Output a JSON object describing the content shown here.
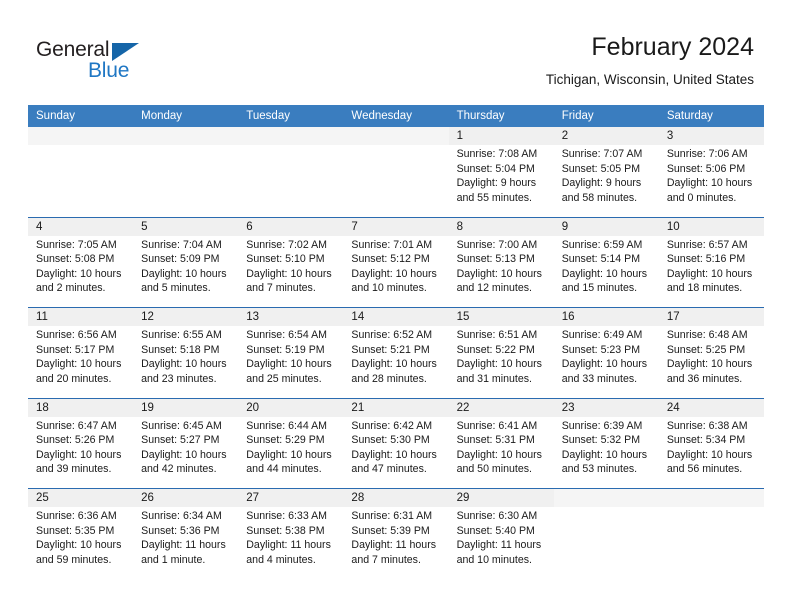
{
  "brand": {
    "name_part1": "General",
    "name_part2": "Blue",
    "triangle_color": "#1565a8",
    "blue_color": "#1f77c4"
  },
  "header": {
    "title": "February 2024",
    "subtitle": "Tichigan, Wisconsin, United States"
  },
  "theme": {
    "header_bar_color": "#3a7dbf",
    "row_rule_color": "#2a6bb0",
    "daynum_band_color": "#f0f0f0"
  },
  "weekday_headers": [
    "Sunday",
    "Monday",
    "Tuesday",
    "Wednesday",
    "Thursday",
    "Friday",
    "Saturday"
  ],
  "weeks": [
    {
      "days": [
        {
          "date": "",
          "sunrise": "",
          "sunset": "",
          "daylight_line1": "",
          "daylight_line2": ""
        },
        {
          "date": "",
          "sunrise": "",
          "sunset": "",
          "daylight_line1": "",
          "daylight_line2": ""
        },
        {
          "date": "",
          "sunrise": "",
          "sunset": "",
          "daylight_line1": "",
          "daylight_line2": ""
        },
        {
          "date": "",
          "sunrise": "",
          "sunset": "",
          "daylight_line1": "",
          "daylight_line2": ""
        },
        {
          "date": "1",
          "sunrise": "Sunrise: 7:08 AM",
          "sunset": "Sunset: 5:04 PM",
          "daylight_line1": "Daylight: 9 hours",
          "daylight_line2": "and 55 minutes."
        },
        {
          "date": "2",
          "sunrise": "Sunrise: 7:07 AM",
          "sunset": "Sunset: 5:05 PM",
          "daylight_line1": "Daylight: 9 hours",
          "daylight_line2": "and 58 minutes."
        },
        {
          "date": "3",
          "sunrise": "Sunrise: 7:06 AM",
          "sunset": "Sunset: 5:06 PM",
          "daylight_line1": "Daylight: 10 hours",
          "daylight_line2": "and 0 minutes."
        }
      ]
    },
    {
      "days": [
        {
          "date": "4",
          "sunrise": "Sunrise: 7:05 AM",
          "sunset": "Sunset: 5:08 PM",
          "daylight_line1": "Daylight: 10 hours",
          "daylight_line2": "and 2 minutes."
        },
        {
          "date": "5",
          "sunrise": "Sunrise: 7:04 AM",
          "sunset": "Sunset: 5:09 PM",
          "daylight_line1": "Daylight: 10 hours",
          "daylight_line2": "and 5 minutes."
        },
        {
          "date": "6",
          "sunrise": "Sunrise: 7:02 AM",
          "sunset": "Sunset: 5:10 PM",
          "daylight_line1": "Daylight: 10 hours",
          "daylight_line2": "and 7 minutes."
        },
        {
          "date": "7",
          "sunrise": "Sunrise: 7:01 AM",
          "sunset": "Sunset: 5:12 PM",
          "daylight_line1": "Daylight: 10 hours",
          "daylight_line2": "and 10 minutes."
        },
        {
          "date": "8",
          "sunrise": "Sunrise: 7:00 AM",
          "sunset": "Sunset: 5:13 PM",
          "daylight_line1": "Daylight: 10 hours",
          "daylight_line2": "and 12 minutes."
        },
        {
          "date": "9",
          "sunrise": "Sunrise: 6:59 AM",
          "sunset": "Sunset: 5:14 PM",
          "daylight_line1": "Daylight: 10 hours",
          "daylight_line2": "and 15 minutes."
        },
        {
          "date": "10",
          "sunrise": "Sunrise: 6:57 AM",
          "sunset": "Sunset: 5:16 PM",
          "daylight_line1": "Daylight: 10 hours",
          "daylight_line2": "and 18 minutes."
        }
      ]
    },
    {
      "days": [
        {
          "date": "11",
          "sunrise": "Sunrise: 6:56 AM",
          "sunset": "Sunset: 5:17 PM",
          "daylight_line1": "Daylight: 10 hours",
          "daylight_line2": "and 20 minutes."
        },
        {
          "date": "12",
          "sunrise": "Sunrise: 6:55 AM",
          "sunset": "Sunset: 5:18 PM",
          "daylight_line1": "Daylight: 10 hours",
          "daylight_line2": "and 23 minutes."
        },
        {
          "date": "13",
          "sunrise": "Sunrise: 6:54 AM",
          "sunset": "Sunset: 5:19 PM",
          "daylight_line1": "Daylight: 10 hours",
          "daylight_line2": "and 25 minutes."
        },
        {
          "date": "14",
          "sunrise": "Sunrise: 6:52 AM",
          "sunset": "Sunset: 5:21 PM",
          "daylight_line1": "Daylight: 10 hours",
          "daylight_line2": "and 28 minutes."
        },
        {
          "date": "15",
          "sunrise": "Sunrise: 6:51 AM",
          "sunset": "Sunset: 5:22 PM",
          "daylight_line1": "Daylight: 10 hours",
          "daylight_line2": "and 31 minutes."
        },
        {
          "date": "16",
          "sunrise": "Sunrise: 6:49 AM",
          "sunset": "Sunset: 5:23 PM",
          "daylight_line1": "Daylight: 10 hours",
          "daylight_line2": "and 33 minutes."
        },
        {
          "date": "17",
          "sunrise": "Sunrise: 6:48 AM",
          "sunset": "Sunset: 5:25 PM",
          "daylight_line1": "Daylight: 10 hours",
          "daylight_line2": "and 36 minutes."
        }
      ]
    },
    {
      "days": [
        {
          "date": "18",
          "sunrise": "Sunrise: 6:47 AM",
          "sunset": "Sunset: 5:26 PM",
          "daylight_line1": "Daylight: 10 hours",
          "daylight_line2": "and 39 minutes."
        },
        {
          "date": "19",
          "sunrise": "Sunrise: 6:45 AM",
          "sunset": "Sunset: 5:27 PM",
          "daylight_line1": "Daylight: 10 hours",
          "daylight_line2": "and 42 minutes."
        },
        {
          "date": "20",
          "sunrise": "Sunrise: 6:44 AM",
          "sunset": "Sunset: 5:29 PM",
          "daylight_line1": "Daylight: 10 hours",
          "daylight_line2": "and 44 minutes."
        },
        {
          "date": "21",
          "sunrise": "Sunrise: 6:42 AM",
          "sunset": "Sunset: 5:30 PM",
          "daylight_line1": "Daylight: 10 hours",
          "daylight_line2": "and 47 minutes."
        },
        {
          "date": "22",
          "sunrise": "Sunrise: 6:41 AM",
          "sunset": "Sunset: 5:31 PM",
          "daylight_line1": "Daylight: 10 hours",
          "daylight_line2": "and 50 minutes."
        },
        {
          "date": "23",
          "sunrise": "Sunrise: 6:39 AM",
          "sunset": "Sunset: 5:32 PM",
          "daylight_line1": "Daylight: 10 hours",
          "daylight_line2": "and 53 minutes."
        },
        {
          "date": "24",
          "sunrise": "Sunrise: 6:38 AM",
          "sunset": "Sunset: 5:34 PM",
          "daylight_line1": "Daylight: 10 hours",
          "daylight_line2": "and 56 minutes."
        }
      ]
    },
    {
      "days": [
        {
          "date": "25",
          "sunrise": "Sunrise: 6:36 AM",
          "sunset": "Sunset: 5:35 PM",
          "daylight_line1": "Daylight: 10 hours",
          "daylight_line2": "and 59 minutes."
        },
        {
          "date": "26",
          "sunrise": "Sunrise: 6:34 AM",
          "sunset": "Sunset: 5:36 PM",
          "daylight_line1": "Daylight: 11 hours",
          "daylight_line2": "and 1 minute."
        },
        {
          "date": "27",
          "sunrise": "Sunrise: 6:33 AM",
          "sunset": "Sunset: 5:38 PM",
          "daylight_line1": "Daylight: 11 hours",
          "daylight_line2": "and 4 minutes."
        },
        {
          "date": "28",
          "sunrise": "Sunrise: 6:31 AM",
          "sunset": "Sunset: 5:39 PM",
          "daylight_line1": "Daylight: 11 hours",
          "daylight_line2": "and 7 minutes."
        },
        {
          "date": "29",
          "sunrise": "Sunrise: 6:30 AM",
          "sunset": "Sunset: 5:40 PM",
          "daylight_line1": "Daylight: 11 hours",
          "daylight_line2": "and 10 minutes."
        },
        {
          "date": "",
          "sunrise": "",
          "sunset": "",
          "daylight_line1": "",
          "daylight_line2": ""
        },
        {
          "date": "",
          "sunrise": "",
          "sunset": "",
          "daylight_line1": "",
          "daylight_line2": ""
        }
      ]
    }
  ]
}
